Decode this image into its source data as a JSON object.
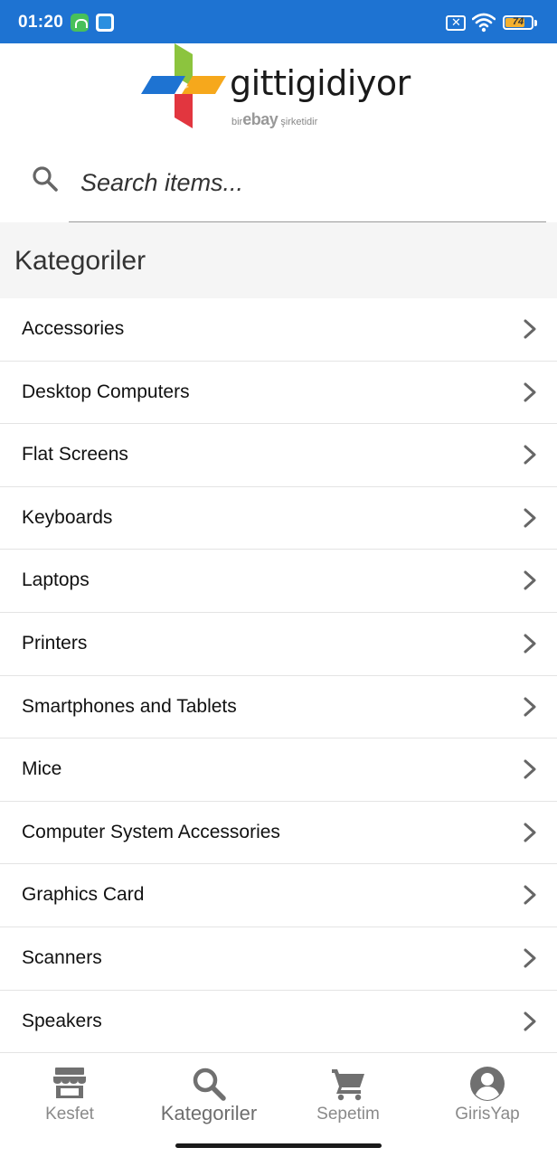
{
  "status_bar": {
    "time": "01:20",
    "battery_level": "74",
    "battery_fraction": 0.74,
    "icons": [
      "android-icon",
      "app-icon",
      "no-sim-icon",
      "wifi-icon",
      "battery-icon"
    ]
  },
  "brand": {
    "name": "gittigidiyor",
    "tagline_prefix": "bir",
    "tagline_brand": "ebay",
    "tagline_suffix": "şirketidir"
  },
  "search": {
    "placeholder": "Search items...",
    "value": ""
  },
  "section": {
    "title": "Kategoriler"
  },
  "categories": [
    {
      "label": "Accessories"
    },
    {
      "label": "Desktop Computers"
    },
    {
      "label": "Flat Screens"
    },
    {
      "label": "Keyboards"
    },
    {
      "label": "Laptops"
    },
    {
      "label": "Printers"
    },
    {
      "label": "Smartphones and Tablets"
    },
    {
      "label": "Mice"
    },
    {
      "label": "Computer System Accessories"
    },
    {
      "label": "Graphics Card"
    },
    {
      "label": "Scanners"
    },
    {
      "label": "Speakers"
    }
  ],
  "tabs": [
    {
      "label": "Kesfet",
      "icon": "store-icon",
      "active": false
    },
    {
      "label": "Kategoriler",
      "icon": "search-icon",
      "active": true
    },
    {
      "label": "Sepetim",
      "icon": "cart-icon",
      "active": false
    },
    {
      "label": "GirisYap",
      "icon": "account-icon",
      "active": false
    }
  ],
  "colors": {
    "status_bar": "#1e73d2",
    "section_bg": "#f5f5f5",
    "icon_gray": "#6e6e6e",
    "logo_green": "#8cc43e",
    "logo_blue": "#1e73d2",
    "logo_orange": "#f6a81c",
    "logo_red": "#e2363f"
  }
}
